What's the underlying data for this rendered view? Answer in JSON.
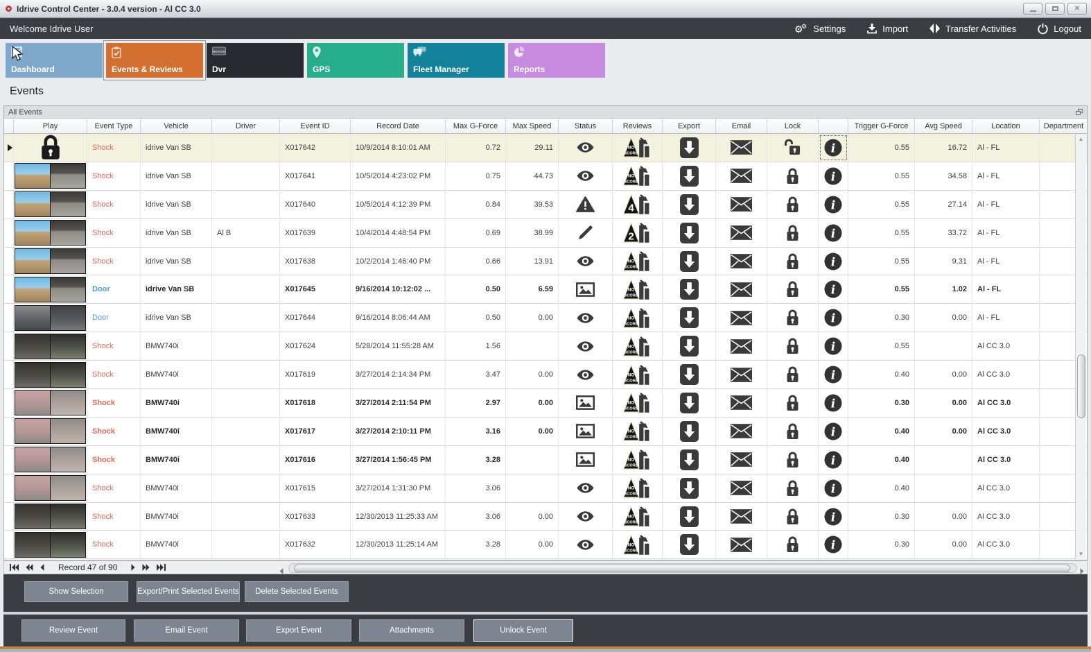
{
  "window": {
    "title": "Idrive Control Center - 3.0.4 version - Al CC 3.0",
    "controls": [
      "minimize",
      "maximize",
      "close"
    ]
  },
  "topbar": {
    "welcome": "Welcome Idrive User",
    "actions": [
      {
        "label": "Settings",
        "icon": "gear-icon"
      },
      {
        "label": "Import",
        "icon": "import-icon"
      },
      {
        "label": "Transfer Activities",
        "icon": "transfer-icon"
      },
      {
        "label": "Logout",
        "icon": "power-icon"
      }
    ]
  },
  "nav_tiles": [
    {
      "label": "Dashboard",
      "color": "#7FA7CA",
      "icon": "line-chart-icon",
      "selected": false
    },
    {
      "label": "Events & Reviews",
      "color": "#D4702F",
      "icon": "clipboard-check-icon",
      "selected": true
    },
    {
      "label": "Dvr",
      "color": "#26292E",
      "icon": "merge-badge-icon",
      "selected": false
    },
    {
      "label": "GPS",
      "color": "#26AD8B",
      "icon": "map-pin-icon",
      "selected": false
    },
    {
      "label": "Fleet Manager",
      "color": "#12839B",
      "icon": "trucks-icon",
      "selected": false
    },
    {
      "label": "Reports",
      "color": "#C78BE0",
      "icon": "pie-chart-icon",
      "selected": false
    }
  ],
  "page_title": "Events",
  "panel_title": "All Events",
  "table": {
    "columns": [
      "",
      "Play",
      "Event Type",
      "Vehicle",
      "Driver",
      "Event ID",
      "Record Date",
      "Max G-Force",
      "Max Speed",
      "Status",
      "Reviews",
      "Export",
      "Email",
      "Lock",
      "",
      "Trigger G-Force",
      "Avg Speed",
      "Location",
      "Department"
    ],
    "rows": [
      {
        "selected": true,
        "bold": false,
        "thumb": "lock",
        "type": "Shock",
        "vehicle": "idrive Van SB",
        "driver": "",
        "id": "X017642",
        "date": "10/9/2014 8:10:01 AM",
        "max_g": "0.72",
        "max_speed": "29.11",
        "status": "eye",
        "review": "no-score",
        "lock": "unlocked",
        "trigger_g": "0.55",
        "avg_speed": "16.72",
        "location": "Al - FL"
      },
      {
        "selected": false,
        "bold": false,
        "thumb": "road",
        "type": "Shock",
        "vehicle": "idrive Van SB",
        "driver": "",
        "id": "X017641",
        "date": "10/5/2014 4:23:02 PM",
        "max_g": "0.75",
        "max_speed": "44.73",
        "status": "eye",
        "review": "no-score",
        "lock": "locked",
        "trigger_g": "0.55",
        "avg_speed": "34.58",
        "location": "Al - FL"
      },
      {
        "selected": false,
        "bold": false,
        "thumb": "road",
        "type": "Shock",
        "vehicle": "idrive Van SB",
        "driver": "",
        "id": "X017640",
        "date": "10/5/2014 4:12:39 PM",
        "max_g": "0.84",
        "max_speed": "39.53",
        "status": "warning",
        "review": "score-4",
        "lock": "locked",
        "trigger_g": "0.55",
        "avg_speed": "27.14",
        "location": "Al - FL"
      },
      {
        "selected": false,
        "bold": false,
        "thumb": "road",
        "type": "Shock",
        "vehicle": "idrive Van SB",
        "driver": "Al B",
        "id": "X017639",
        "date": "10/4/2014 4:48:54 PM",
        "max_g": "0.69",
        "max_speed": "38.99",
        "status": "pencil",
        "review": "score-2",
        "lock": "locked",
        "trigger_g": "0.55",
        "avg_speed": "33.72",
        "location": "Al - FL"
      },
      {
        "selected": false,
        "bold": false,
        "thumb": "road",
        "type": "Shock",
        "vehicle": "idrive Van SB",
        "driver": "",
        "id": "X017638",
        "date": "10/2/2014 1:46:40 PM",
        "max_g": "0.66",
        "max_speed": "13.91",
        "status": "eye",
        "review": "no-score",
        "lock": "locked",
        "trigger_g": "0.55",
        "avg_speed": "9.31",
        "location": "Al - FL"
      },
      {
        "selected": false,
        "bold": true,
        "thumb": "road",
        "type": "Door",
        "vehicle": "idrive Van SB",
        "driver": "",
        "id": "X017645",
        "date": "9/16/2014 10:12:02 ...",
        "max_g": "0.50",
        "max_speed": "6.59",
        "status": "image",
        "review": "no-score",
        "lock": "locked",
        "trigger_g": "0.55",
        "avg_speed": "1.02",
        "location": "Al - FL"
      },
      {
        "selected": false,
        "bold": false,
        "thumb": "dim",
        "type": "Door",
        "vehicle": "idrive Van SB",
        "driver": "",
        "id": "X017644",
        "date": "9/16/2014 8:06:44 AM",
        "max_g": "0.50",
        "max_speed": "0.00",
        "status": "eye",
        "review": "no-score",
        "lock": "locked",
        "trigger_g": "0.30",
        "avg_speed": "0.00",
        "location": "Al - FL"
      },
      {
        "selected": false,
        "bold": false,
        "thumb": "dark",
        "type": "Shock",
        "vehicle": "BMW740i",
        "driver": "",
        "id": "X017624",
        "date": "5/28/2014 11:55:28 AM",
        "max_g": "1.56",
        "max_speed": "",
        "status": "eye",
        "review": "no-score",
        "lock": "locked",
        "trigger_g": "0.55",
        "avg_speed": "",
        "location": "Al CC 3.0"
      },
      {
        "selected": false,
        "bold": false,
        "thumb": "dark",
        "type": "Shock",
        "vehicle": "BMW740i",
        "driver": "",
        "id": "X017619",
        "date": "3/27/2014 2:14:34 PM",
        "max_g": "3.47",
        "max_speed": "0.00",
        "status": "eye",
        "review": "no-score",
        "lock": "locked",
        "trigger_g": "0.40",
        "avg_speed": "0.00",
        "location": "Al CC 3.0"
      },
      {
        "selected": false,
        "bold": true,
        "thumb": "pink",
        "type": "Shock",
        "vehicle": "BMW740i",
        "driver": "",
        "id": "X017618",
        "date": "3/27/2014 2:11:54 PM",
        "max_g": "2.97",
        "max_speed": "0.00",
        "status": "image",
        "review": "no-score",
        "lock": "locked",
        "trigger_g": "0.30",
        "avg_speed": "0.00",
        "location": "Al CC 3.0"
      },
      {
        "selected": false,
        "bold": true,
        "thumb": "pink",
        "type": "Shock",
        "vehicle": "BMW740i",
        "driver": "",
        "id": "X017617",
        "date": "3/27/2014 2:10:11 PM",
        "max_g": "3.16",
        "max_speed": "0.00",
        "status": "image",
        "review": "no-score",
        "lock": "locked",
        "trigger_g": "0.40",
        "avg_speed": "0.00",
        "location": "Al CC 3.0"
      },
      {
        "selected": false,
        "bold": true,
        "thumb": "pink",
        "type": "Shock",
        "vehicle": "BMW740i",
        "driver": "",
        "id": "X017616",
        "date": "3/27/2014 1:56:45 PM",
        "max_g": "3.28",
        "max_speed": "",
        "status": "image",
        "review": "no-score",
        "lock": "locked",
        "trigger_g": "0.40",
        "avg_speed": "",
        "location": "Al CC 3.0"
      },
      {
        "selected": false,
        "bold": false,
        "thumb": "pink",
        "type": "Shock",
        "vehicle": "BMW740i",
        "driver": "",
        "id": "X017615",
        "date": "3/27/2014 1:31:30 PM",
        "max_g": "3.06",
        "max_speed": "",
        "status": "eye",
        "review": "no-score",
        "lock": "locked",
        "trigger_g": "0.40",
        "avg_speed": "",
        "location": "Al CC 3.0"
      },
      {
        "selected": false,
        "bold": false,
        "thumb": "dark",
        "type": "Shock",
        "vehicle": "BMW740i",
        "driver": "",
        "id": "X017633",
        "date": "12/30/2013 11:25:33 AM",
        "max_g": "3.06",
        "max_speed": "0.00",
        "status": "eye",
        "review": "no-score",
        "lock": "locked",
        "trigger_g": "0.30",
        "avg_speed": "0.00",
        "location": "Al CC 3.0"
      },
      {
        "selected": false,
        "bold": false,
        "thumb": "dark",
        "type": "Shock",
        "vehicle": "BMW740i",
        "driver": "",
        "id": "X017632",
        "date": "12/30/2013 11:25:14 AM",
        "max_g": "3.28",
        "max_speed": "0.00",
        "status": "eye",
        "review": "no-score",
        "lock": "locked",
        "trigger_g": "0.30",
        "avg_speed": "0.00",
        "location": "Al CC 3.0"
      }
    ]
  },
  "pagination": {
    "record_text": "Record 47 of 90"
  },
  "selection_buttons": [
    "Show Selection",
    "Export/Print Selected Events",
    "Delete Selected  Events"
  ],
  "footer_buttons": [
    "Review Event",
    "Email Event",
    "Export Event",
    "Attachments",
    "Unlock Event"
  ],
  "colors": {
    "selected_row": "#F2F2DE",
    "shock_text": "#E0695B",
    "door_text": "#4D9FD9",
    "accent_orange": "#D4702F",
    "topbar_dark": "#3A3D41",
    "bottom_line": "#C08640"
  }
}
